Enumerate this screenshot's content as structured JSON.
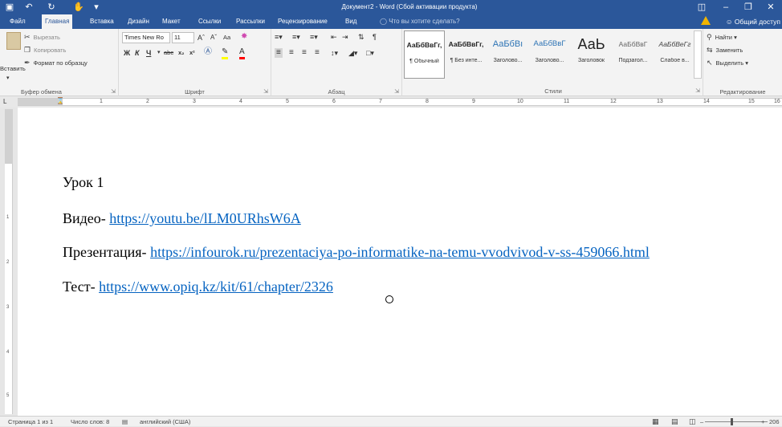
{
  "titlebar": {
    "title": "Документ2 - Word (Сбой активации продукта)",
    "qa_icons": [
      "save-icon",
      "undo-icon",
      "redo-icon",
      "touch-mode-icon",
      "customize-icon"
    ]
  },
  "tabs": [
    "Файл",
    "Главная",
    "Вставка",
    "Дизайн",
    "Макет",
    "Ссылки",
    "Рассылки",
    "Рецензирование",
    "Вид"
  ],
  "tellme": "Что вы хотите сделать?",
  "share": "Общий доступ",
  "clipboard": {
    "paste": "Вставить",
    "cut": "Вырезать",
    "copy": "Копировать",
    "format_painter": "Формат по образцу",
    "label": "Буфер обмена"
  },
  "font": {
    "family": "Times New Ro",
    "size": "11",
    "label": "Шрифт",
    "case": "Aa",
    "bold": "Ж",
    "italic": "К",
    "underline": "Ч",
    "strike": "abc",
    "subscript": "x₂",
    "superscript": "x²"
  },
  "paragraph": {
    "label": "Абзац"
  },
  "styles": {
    "label": "Стили",
    "items": [
      {
        "sample": "АаБбВвГг,",
        "name": "¶ Обычный"
      },
      {
        "sample": "АаБбВвГг,",
        "name": "¶ Без инте..."
      },
      {
        "sample": "АаБбВı",
        "name": "Заголово..."
      },
      {
        "sample": "АаБбВвГ",
        "name": "Заголово..."
      },
      {
        "sample": "АаЬ",
        "name": "Заголовок"
      },
      {
        "sample": "АаБбВвГ",
        "name": "Подзагол..."
      },
      {
        "sample": "АаБбВеГг",
        "name": "Слабое в..."
      }
    ]
  },
  "editing": {
    "find": "Найти",
    "replace": "Заменить",
    "select": "Выделить",
    "label": "Редактирование"
  },
  "ruler": {
    "numbers": [
      "1",
      "2",
      "3",
      "4",
      "5",
      "6",
      "7",
      "8",
      "9",
      "10",
      "11",
      "12",
      "13",
      "14",
      "15",
      "16"
    ]
  },
  "vruler": {
    "numbers": [
      "1",
      "2",
      "3",
      "4",
      "5"
    ]
  },
  "document": {
    "line1": "Урок 1",
    "line2_label": "Видео- ",
    "line2_link": "https://youtu.be/lLM0URhsW6A",
    "line3_label": "Презентация- ",
    "line3_link": "https://infourok.ru/prezentaciya-po-informatike-na-temu-vvodvivod-v-ss-459066.html",
    "line4_label": "Тест- ",
    "line4_link": "https://www.opiq.kz/kit/61/chapter/2326"
  },
  "statusbar": {
    "page": "Страница 1 из 1",
    "words": "Число слов: 8",
    "language": "английский (США)",
    "zoom": "206"
  },
  "colors": {
    "accent": "#2b579a",
    "link": "#0563c1"
  }
}
